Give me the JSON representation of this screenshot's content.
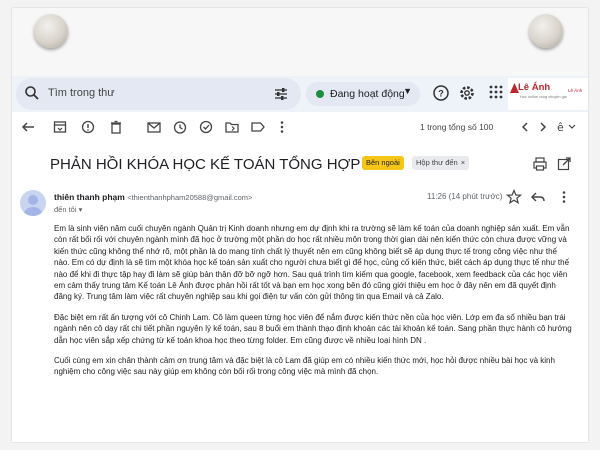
{
  "colors": {
    "topbar_bg": "#eef2f9",
    "active_dot": "#1e8e3e",
    "external_badge": "#f5c518",
    "brand_red": "#c0262d"
  },
  "search": {
    "placeholder": "Tìm trong thư",
    "icon": "search-icon",
    "options_icon": "tune-icon"
  },
  "status": {
    "label": "Đang hoạt động",
    "icon": "green-dot"
  },
  "header_icons": [
    "help-icon",
    "settings-icon",
    "apps-icon"
  ],
  "brand": {
    "name": "Lê Ánh",
    "tagline": "Học online cùng chuyên gia"
  },
  "toolbar": {
    "icons": [
      "back-arrow-icon",
      "archive-icon",
      "report-spam-icon",
      "delete-icon",
      "mark-unread-icon",
      "snooze-icon",
      "add-task-icon",
      "move-to-icon",
      "label-icon",
      "more-vert-icon"
    ],
    "pager_text": "1 trong tổng số 100",
    "nav_icons": [
      "chevron-left-icon",
      "chevron-right-icon",
      "input-tools-icon"
    ]
  },
  "email": {
    "subject": "PHẢN HỒI KHÓA HỌC KẾ TOÁN TỔNG HỢP K144",
    "labels": {
      "external": "Bên ngoài",
      "inbox": "Hộp thư đến",
      "remove_symbol": "×"
    },
    "sender_name": "thiên thanh phạm",
    "sender_email": "<thienthanhpham20588@gmail.com>",
    "to_text": "đến tôi",
    "time": "11:26 (14 phút trước)",
    "paragraphs": [
      "Em là sinh viên năm cuối chuyên ngành Quản trị Kinh doanh nhưng em dự định khi ra trường sẽ làm kế toán của doanh nghiệp sản xuất. Em vẫn còn rất bối rối với chuyên ngành mình đã học ở trường một phần do học rất nhiều môn trong thời gian dài nên kiến thức còn chưa được vững và kiến thức cũng không thể nhớ rõ, một phần là do mang tính chất lý thuyết nên em cũng không biết sẽ áp dụng thực tế trong công việc như thế nào. Em có dự định là sẽ tìm một khóa học kế toán sản xuất cho người chưa biết gì để học, củng cố kiến thức, biết cách áp dụng thực tế như thế nào để khi đi thực tập hay đi làm sẽ giúp bản thân đỡ bỡ ngỡ hơn. Sau quá trình tìm kiếm qua google, facebook, xem feedback của các học viên em cảm thấy trung tâm Kế toán Lê Ánh được phản hồi rất tốt và bạn em học xong bên đó cũng giới thiệu em học ở đây nên em đã quyết định đăng ký. Trung tâm làm việc rất chuyên nghiệp sau khi gọi điện tư vấn còn gửi thông tin qua Email và cả Zalo.",
      "Đặc biệt em rất ấn tượng với cô Chinh Lam. Cô làm queen từng học viên để nắm được kiến thức nền của học viên. Lớp em đa số nhiều bạn trái ngành nên cô dạy rất chi tiết phần nguyên lý kế toán, sau 8 buổi em thành thạo định khoản các tài khoản kế toán. Sang phần thực hành cô hướng dẫn học viên sắp xếp chứng từ kế toán khoa học theo từng folder. Em cũng được về nhiều loại hình DN .",
      "Cuối cùng em xin chân thành cảm ơn trung tâm và đặc biệt là cô Lam đã giúp em có nhiều kiến thức mới, học hỏi được nhiều bài học và kinh nghiệm cho công việc sau này giúp em không còn bối rối trong công việc mà mình đã chọn."
    ]
  }
}
